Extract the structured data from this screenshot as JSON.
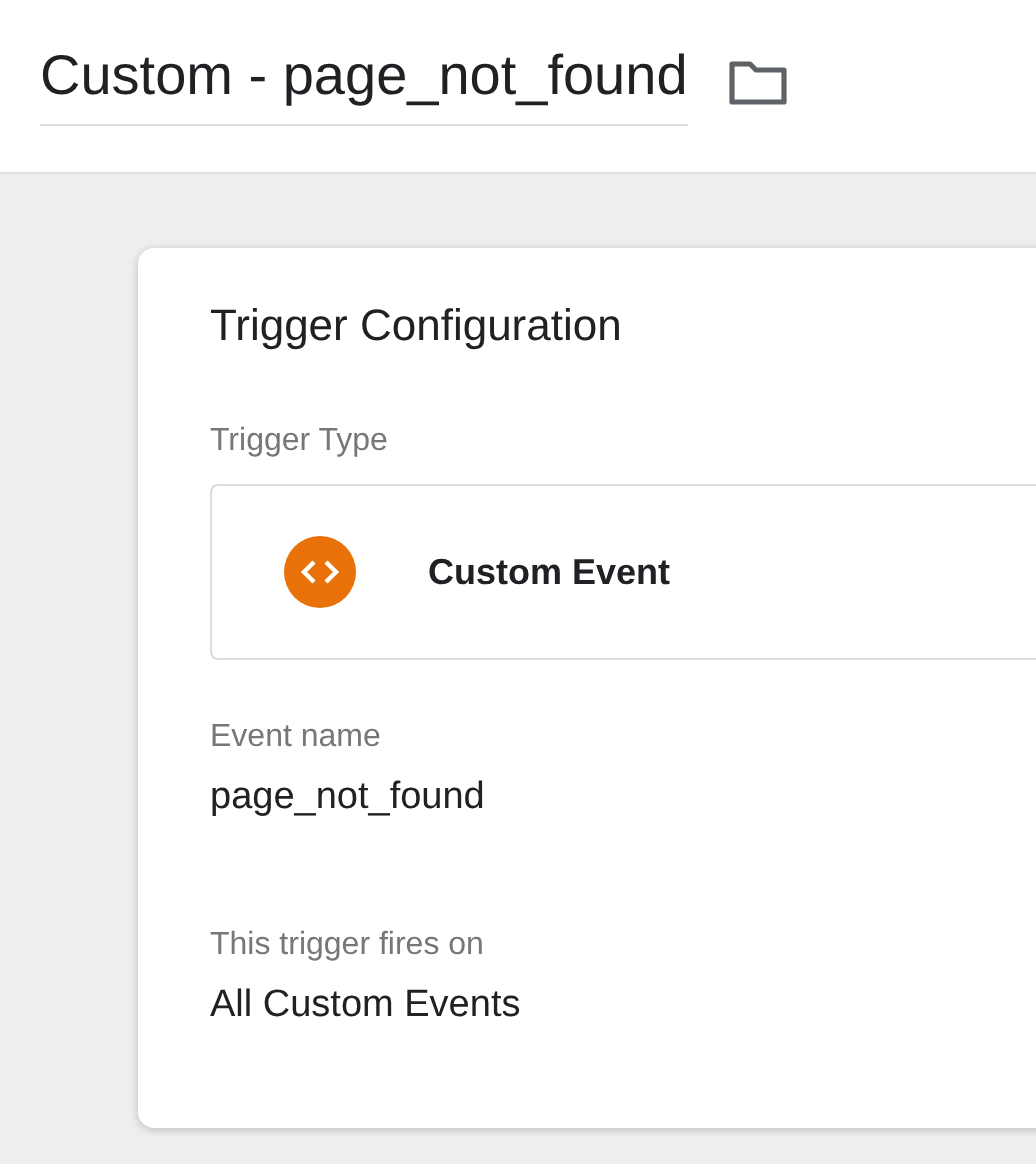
{
  "header": {
    "title": "Custom - page_not_found"
  },
  "card": {
    "title": "Trigger Configuration",
    "trigger_type": {
      "label": "Trigger Type",
      "value": "Custom Event"
    },
    "fields": [
      {
        "label": "Event name",
        "value": "page_not_found"
      },
      {
        "label": "This trigger fires on",
        "value": "All Custom Events"
      }
    ]
  }
}
